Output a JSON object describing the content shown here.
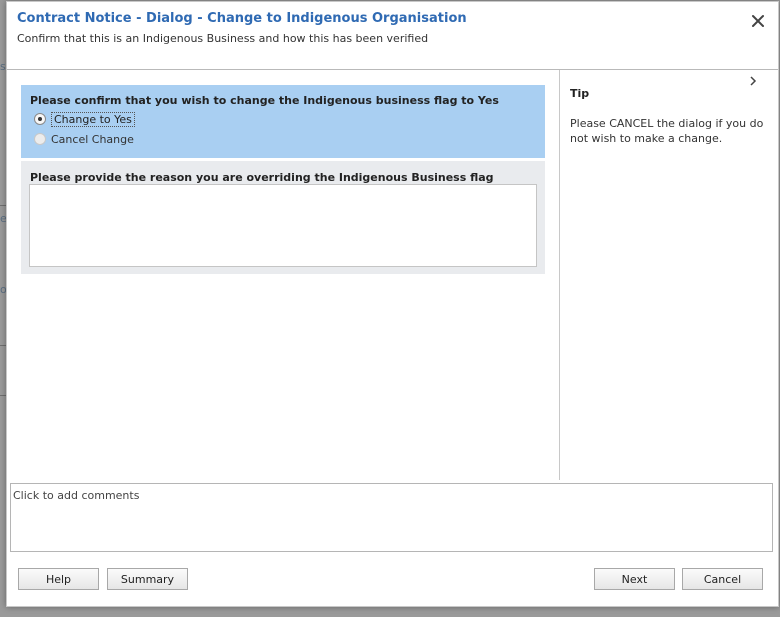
{
  "background": {
    "left_edge_chars": [
      "s",
      "e",
      "o"
    ]
  },
  "dialog": {
    "title": "Contract Notice - Dialog - Change to Indigenous Organisation",
    "subtitle": "Confirm that this is an Indigenous Business and how this has been verified",
    "close_icon": "close-icon"
  },
  "question1": {
    "label": "Please confirm that you wish to change the Indigenous business flag to Yes",
    "options": [
      {
        "label": "Change to Yes",
        "selected": true
      },
      {
        "label": "Cancel Change",
        "selected": false
      }
    ]
  },
  "question2": {
    "label": "Please provide the reason you are overriding the Indigenous Business flag",
    "value": ""
  },
  "tip": {
    "title": "Tip",
    "text": "Please CANCEL the dialog if you do not wish to make a change.",
    "chevron_icon": "chevron-right-icon"
  },
  "comments": {
    "placeholder": "Click to add comments"
  },
  "buttons": {
    "help": "Help",
    "summary": "Summary",
    "next": "Next",
    "cancel": "Cancel"
  },
  "colors": {
    "title": "#2f6ab3",
    "question_highlight": "#a9cff2",
    "question_panel": "#e9ebee"
  }
}
